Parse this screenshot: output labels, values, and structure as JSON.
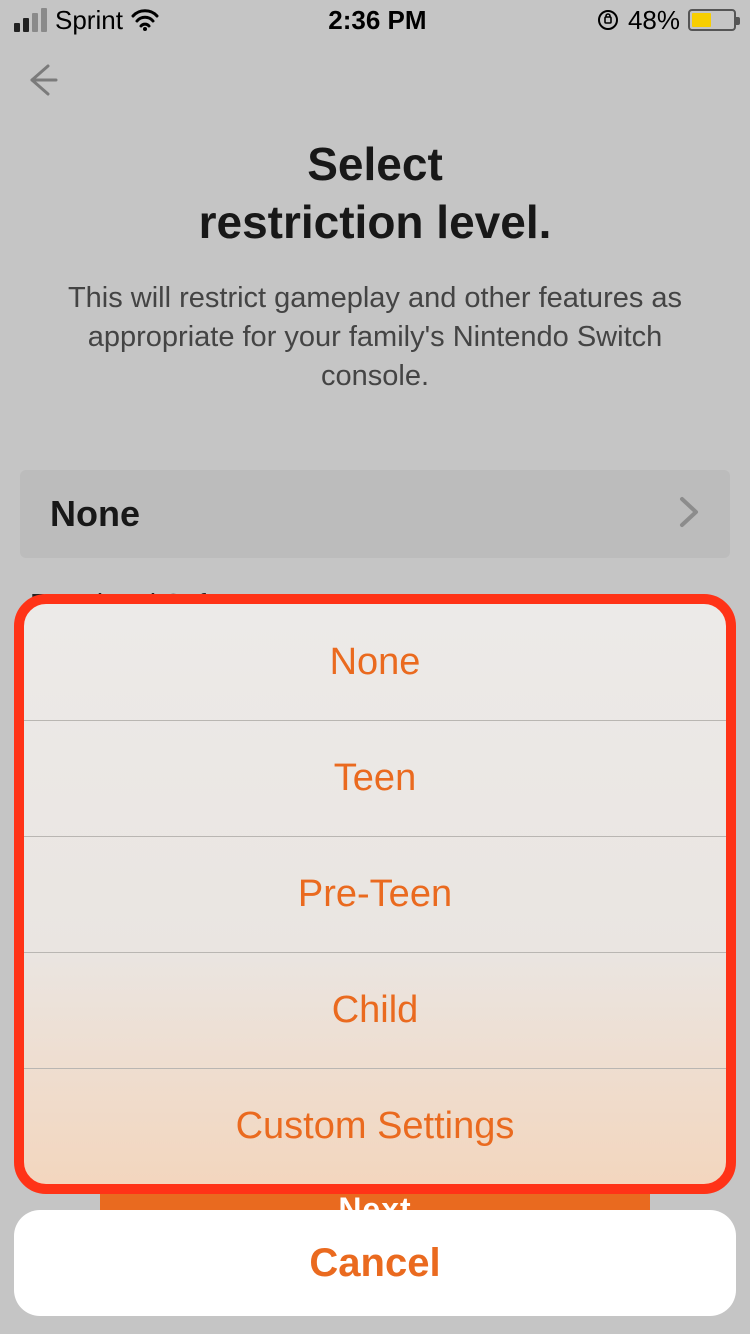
{
  "status_bar": {
    "carrier": "Sprint",
    "time": "2:36 PM",
    "battery_pct": "48%"
  },
  "header": {
    "title_line1": "Select",
    "title_line2": "restriction level.",
    "subtitle": "This will restrict gameplay and other features as appropriate for your family's Nintendo Switch console."
  },
  "selector": {
    "current": "None"
  },
  "section": {
    "restricted_software_label": "Restricted Software:"
  },
  "next_button": "Next",
  "action_sheet": {
    "options": {
      "0": "None",
      "1": "Teen",
      "2": "Pre-Teen",
      "3": "Child",
      "4": "Custom Settings"
    },
    "cancel": "Cancel"
  },
  "colors": {
    "accent": "#ea6a1f",
    "highlight_border": "#ff3317"
  }
}
